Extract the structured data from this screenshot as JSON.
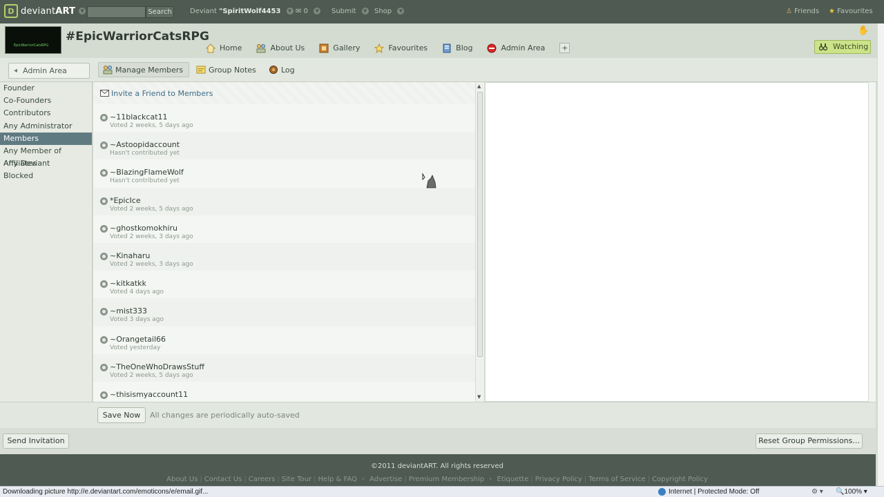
{
  "topbar": {
    "brand_light": "deviant",
    "brand_bold": "ART",
    "search_button": "Search",
    "deviant_label": "Deviant",
    "username": "\"SpiritWolf4453",
    "message_count": "0",
    "submit": "Submit",
    "shop": "Shop",
    "friends": "Friends",
    "favourites": "Favourites"
  },
  "header": {
    "avatar_text": "EpicWarriorCatsRPG",
    "group_title": "#EpicWarriorCatsRPG",
    "nav": [
      "Home",
      "About Us",
      "Gallery",
      "Favourites",
      "Blog",
      "Admin Area"
    ],
    "plus": "+",
    "watching": "Watching"
  },
  "subbar": {
    "admin_home": "Admin Area Home",
    "tabs": [
      "Manage Members",
      "Group Notes",
      "Log"
    ]
  },
  "roles": [
    "Founder",
    "Co-Founders",
    "Contributors",
    "Any Administrator",
    "Members",
    "Any Member of Affiliates",
    "Any Deviant",
    "Blocked"
  ],
  "selected_role": "Members",
  "invite_label": "Invite a Friend to Members",
  "members": [
    {
      "name": "~11blackcat11",
      "status": "Voted 2 weeks, 5 days ago"
    },
    {
      "name": "~Astoopidaccount",
      "status": "Hasn't contributed yet"
    },
    {
      "name": "~BlazingFlameWolf",
      "status": "Hasn't contributed yet"
    },
    {
      "name": "*EpicIce",
      "status": "Voted 2 weeks, 5 days ago"
    },
    {
      "name": "~ghostkomokhiru",
      "status": "Voted 2 weeks, 3 days ago"
    },
    {
      "name": "~Kinaharu",
      "status": "Voted 2 weeks, 3 days ago"
    },
    {
      "name": "~kitkatkk",
      "status": "Voted 4 days ago"
    },
    {
      "name": "~mist333",
      "status": "Voted 3 days ago"
    },
    {
      "name": "~Orangetail66",
      "status": "Voted yesterday"
    },
    {
      "name": "~TheOneWhoDrawsStuff",
      "status": "Voted 2 weeks, 5 days ago"
    },
    {
      "name": "~thisismyaccount11",
      "status": ""
    }
  ],
  "savebar": {
    "save_now": "Save Now",
    "autosave_note": "All changes are periodically auto-saved"
  },
  "bottombar": {
    "send_invitation": "Send Invitation",
    "reset_permissions": "Reset Group Permissions..."
  },
  "footer": {
    "copyright": "©2011 deviantART. All rights reserved",
    "links_group1": [
      "About Us",
      "Contact Us",
      "Careers",
      "Site Tour",
      "Help & FAQ"
    ],
    "links_group2": [
      "Advertise",
      "Premium Membership"
    ],
    "links_group3": [
      "Etiquette",
      "Privacy Policy",
      "Terms of Service",
      "Copyright Policy"
    ]
  },
  "statusbar": {
    "status_text": "Downloading picture http://e.deviantart.com/emoticons/e/email.gif...",
    "zone": "Internet | Protected Mode: Off",
    "zoom": "100%"
  },
  "colors": {
    "topbar_bg": "#4e5a52",
    "selected_role_bg": "#607a82",
    "watch_green": "#cde38a",
    "link_blue": "#3f6c88"
  }
}
